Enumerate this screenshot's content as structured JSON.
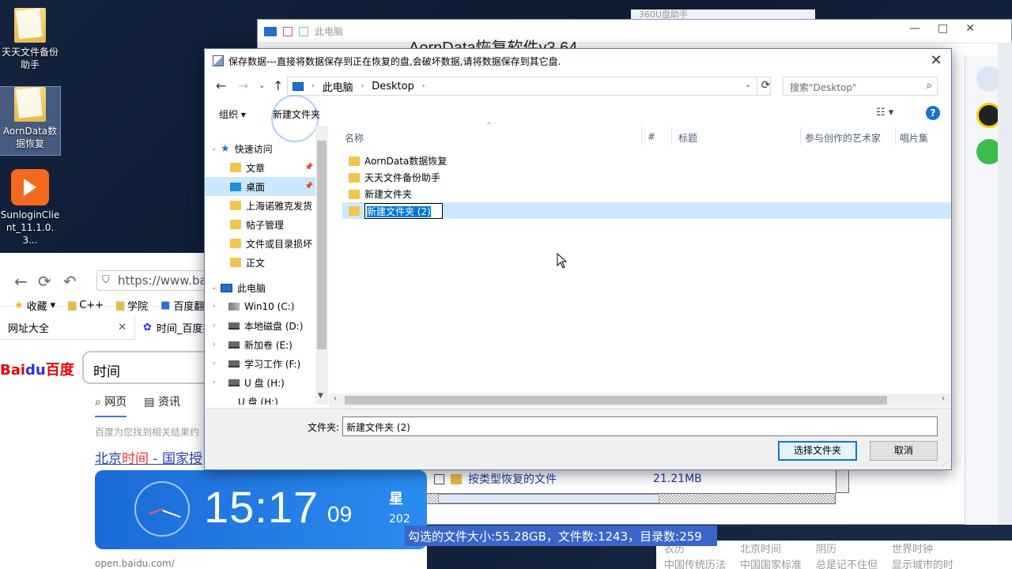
{
  "desktop": {
    "icons": [
      {
        "label": "天天文件备份助手"
      },
      {
        "label": "AornData数据恢复"
      },
      {
        "label": "SunloginClient_11.1.0.3..."
      }
    ]
  },
  "bg_window": {
    "titlebar_text": "此电脑",
    "app_title": "AornData恢复软件v3.64",
    "popup_title": "360U盘助手",
    "tree_row": {
      "label": "按类型恢复的文件",
      "size": "21.21MB"
    },
    "status_text": "勾选的文件大小:55.28GB，文件数:1243，目录数:259"
  },
  "browser": {
    "url": "https://www.bai",
    "bookmarks": [
      "收藏",
      "C++",
      "学院",
      "百度翻译"
    ],
    "tabs": [
      "网址大全",
      "时间_百度搜"
    ],
    "logo": {
      "bai": "Bai",
      "du": "du",
      "cn": "百度"
    },
    "search_query": "时间",
    "subtabs": [
      "网页",
      "资讯"
    ],
    "hint": "百度为您找到相关结果约",
    "result_title": {
      "pre": "北京",
      "hl": "时间",
      "post": " - 国家授"
    },
    "clock": {
      "time": "15:17",
      "seconds": "09",
      "week": "星",
      "date": "202"
    },
    "footer_url": "open.baidu.com/"
  },
  "calendar_strip": {
    "cols": [
      {
        "top": "农历",
        "bottom": "中国传统历法"
      },
      {
        "top": "北京时间",
        "bottom": "中国国家标准"
      },
      {
        "top": "阴历",
        "bottom": "总是记不住但"
      },
      {
        "top": "世界时钟",
        "bottom": "显示城市的时"
      }
    ]
  },
  "dialog": {
    "title": "保存数据---直接将数据保存到正在恢复的盘,会破坏数据,请将数据保存到其它盘.",
    "breadcrumb": [
      "此电脑",
      "Desktop"
    ],
    "search_placeholder": "搜索\"Desktop\"",
    "organize_label": "组织 ▾",
    "new_folder_label": "新建文件夹",
    "nav": {
      "quick_access": "快速访问",
      "quick_items": [
        "文章",
        "桌面",
        "上海诺雅克发货",
        "帖子管理",
        "文件或目录损坏",
        "正文"
      ],
      "this_pc": "此电脑",
      "drives": [
        "Win10 (C:)",
        "本地磁盘 (D:)",
        "新加卷 (E:)",
        "学习工作 (F:)",
        "U 盘 (H:)",
        "U 盘 (H:)"
      ]
    },
    "columns": [
      "名称",
      "#",
      "标题",
      "参与创作的艺术家",
      "唱片集"
    ],
    "files": [
      "AornData数据恢复",
      "天天文件备份助手",
      "新建文件夹"
    ],
    "renaming_file": "新建文件夹 (2)",
    "folder_label": "文件夹:",
    "folder_value": "新建文件夹 (2)",
    "select_button": "选择文件夹",
    "cancel_button": "取消"
  }
}
